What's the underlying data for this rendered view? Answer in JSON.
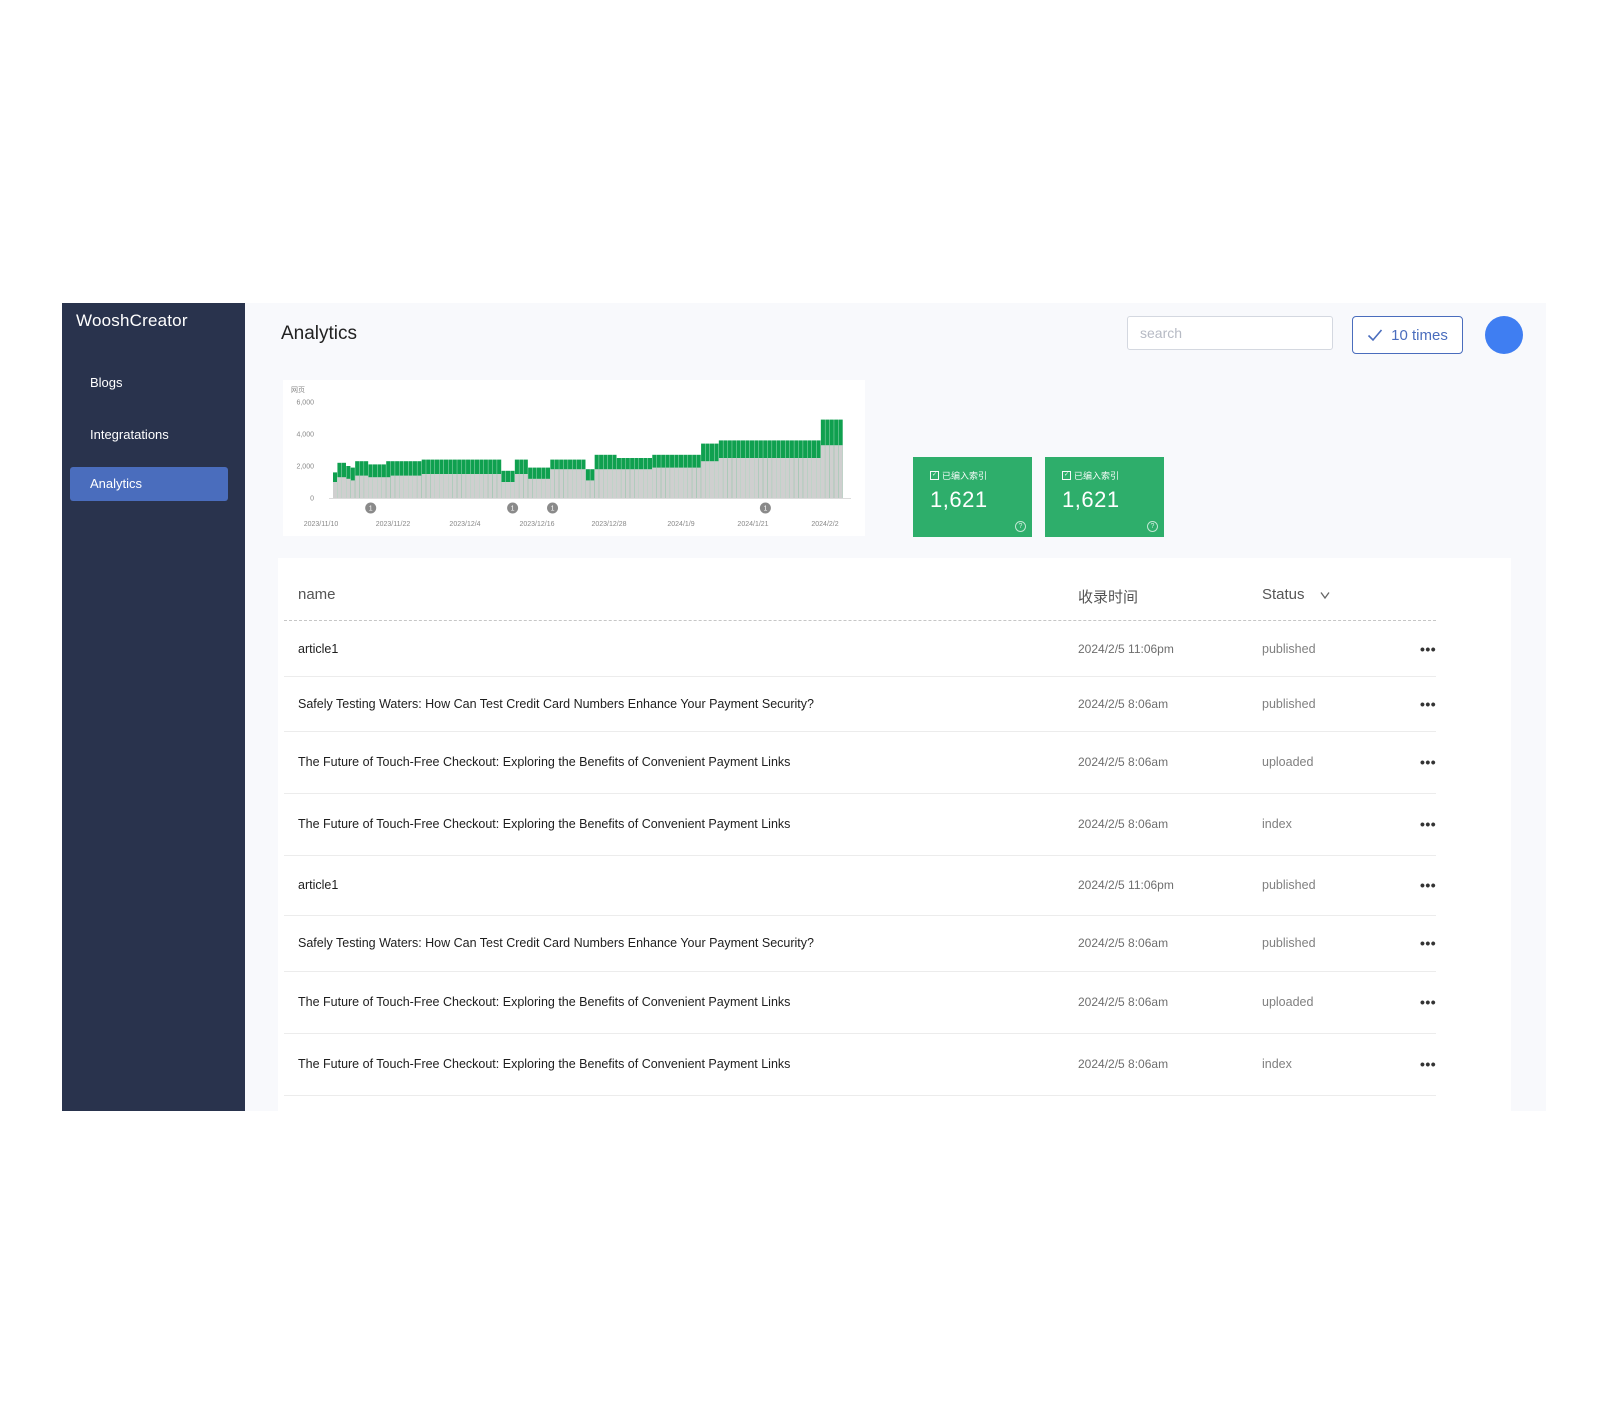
{
  "sidebar": {
    "brand": "WooshCreator",
    "items": [
      {
        "label": "Blogs",
        "active": false
      },
      {
        "label": "Integratations",
        "active": false
      },
      {
        "label": "Analytics",
        "active": true
      }
    ]
  },
  "header": {
    "title": "Analytics",
    "search_placeholder": "search",
    "times_button": "10 times",
    "times_icon": "check-icon"
  },
  "chart_data": {
    "type": "bar",
    "unit_label": "网页",
    "ylim": [
      0,
      6000
    ],
    "yticks": [
      "6,000",
      "4,000",
      "2,000",
      "0"
    ],
    "xtick_labels": [
      "2023/11/10",
      "2023/11/22",
      "2023/12/4",
      "2023/12/16",
      "2023/12/28",
      "2024/1/9",
      "2024/1/21",
      "2024/2/2"
    ],
    "grid": false,
    "colors": {
      "green": "#0fa04f",
      "gray": "#cfcfcf"
    },
    "markers": [
      {
        "label": "1",
        "index": 8
      },
      {
        "label": "1",
        "index": 40
      },
      {
        "label": "1",
        "index": 49
      },
      {
        "label": "1",
        "index": 97
      }
    ],
    "series": [
      {
        "values": [
          1600,
          2200,
          2200,
          2000,
          1900,
          2300,
          2300,
          2300,
          2100,
          2100,
          2100,
          2100,
          2300,
          2300,
          2300,
          2300,
          2300,
          2300,
          2300,
          2300,
          2400,
          2400,
          2400,
          2400,
          2400,
          2400,
          2400,
          2400,
          2400,
          2400,
          2400,
          2400,
          2400,
          2400,
          2400,
          2400,
          2400,
          2400,
          1700,
          1700,
          1700,
          2400,
          2400,
          2400,
          1900,
          1900,
          1900,
          1900,
          1900,
          2400,
          2400,
          2400,
          2400,
          2400,
          2400,
          2400,
          2400,
          1800,
          1800,
          2700,
          2700,
          2700,
          2700,
          2700,
          2500,
          2500,
          2500,
          2500,
          2500,
          2500,
          2500,
          2500,
          2700,
          2700,
          2700,
          2700,
          2700,
          2700,
          2700,
          2700,
          2700,
          2700,
          2700,
          3400,
          3400,
          3400,
          3400,
          3600,
          3600,
          3600,
          3600,
          3600,
          3600,
          3600,
          3600,
          3600,
          3600,
          3600,
          3600,
          3600,
          3600,
          3600,
          3600,
          3600,
          3600,
          3600,
          3600,
          3600,
          3600,
          3600,
          4900,
          4900,
          4900,
          4900,
          4900
        ]
      },
      {
        "values": [
          1000,
          1300,
          1300,
          1200,
          1100,
          1400,
          1400,
          1400,
          1300,
          1300,
          1300,
          1300,
          1300,
          1400,
          1400,
          1400,
          1400,
          1400,
          1400,
          1400,
          1500,
          1500,
          1500,
          1500,
          1500,
          1500,
          1500,
          1500,
          1500,
          1500,
          1500,
          1500,
          1500,
          1500,
          1500,
          1500,
          1500,
          1500,
          1000,
          1000,
          1000,
          1500,
          1500,
          1500,
          1200,
          1200,
          1200,
          1200,
          1200,
          1800,
          1800,
          1800,
          1800,
          1800,
          1800,
          1800,
          1800,
          1100,
          1100,
          1800,
          1800,
          1800,
          1800,
          1800,
          1800,
          1800,
          1800,
          1800,
          1800,
          1800,
          1800,
          1800,
          1900,
          1900,
          1900,
          1900,
          1900,
          1900,
          1900,
          1900,
          1900,
          1900,
          1900,
          2300,
          2300,
          2300,
          2300,
          2500,
          2500,
          2500,
          2500,
          2500,
          2500,
          2500,
          2500,
          2500,
          2500,
          2500,
          2500,
          2500,
          2500,
          2500,
          2500,
          2500,
          2500,
          2500,
          2500,
          2500,
          2500,
          2500,
          3300,
          3300,
          3300,
          3300,
          3300
        ]
      }
    ]
  },
  "stats": [
    {
      "label": "已编入索引",
      "value": "1,621",
      "help_icon": "question-icon"
    },
    {
      "label": "已编入索引",
      "value": "1,621",
      "help_icon": "question-icon"
    }
  ],
  "table": {
    "columns": {
      "name": "name",
      "time": "收录时间",
      "status": "Status",
      "status_sort_icon": "chevron-down-icon"
    },
    "more_symbol": "•••",
    "rows": [
      {
        "name": "article1",
        "time": "2024/2/5 11:06pm",
        "status": "published"
      },
      {
        "name": "Safely Testing Waters: How Can Test Credit Card Numbers Enhance Your Payment Security?",
        "time": "2024/2/5 8:06am",
        "status": "published"
      },
      {
        "name": "The Future of Touch-Free Checkout: Exploring the Benefits of Convenient Payment Links",
        "time": "2024/2/5 8:06am",
        "status": "uploaded"
      },
      {
        "name": "The Future of Touch-Free Checkout: Exploring the Benefits of Convenient Payment Links",
        "time": "2024/2/5 8:06am",
        "status": "index"
      },
      {
        "name": "article1",
        "time": "2024/2/5 11:06pm",
        "status": "published"
      },
      {
        "name": "Safely Testing Waters: How Can Test Credit Card Numbers Enhance Your Payment Security?",
        "time": "2024/2/5 8:06am",
        "status": "published"
      },
      {
        "name": "The Future of Touch-Free Checkout: Exploring the Benefits of Convenient Payment Links",
        "time": "2024/2/5 8:06am",
        "status": "uploaded"
      },
      {
        "name": "The Future of Touch-Free Checkout: Exploring the Benefits of Convenient Payment Links",
        "time": "2024/2/5 8:06am",
        "status": "index"
      }
    ]
  }
}
